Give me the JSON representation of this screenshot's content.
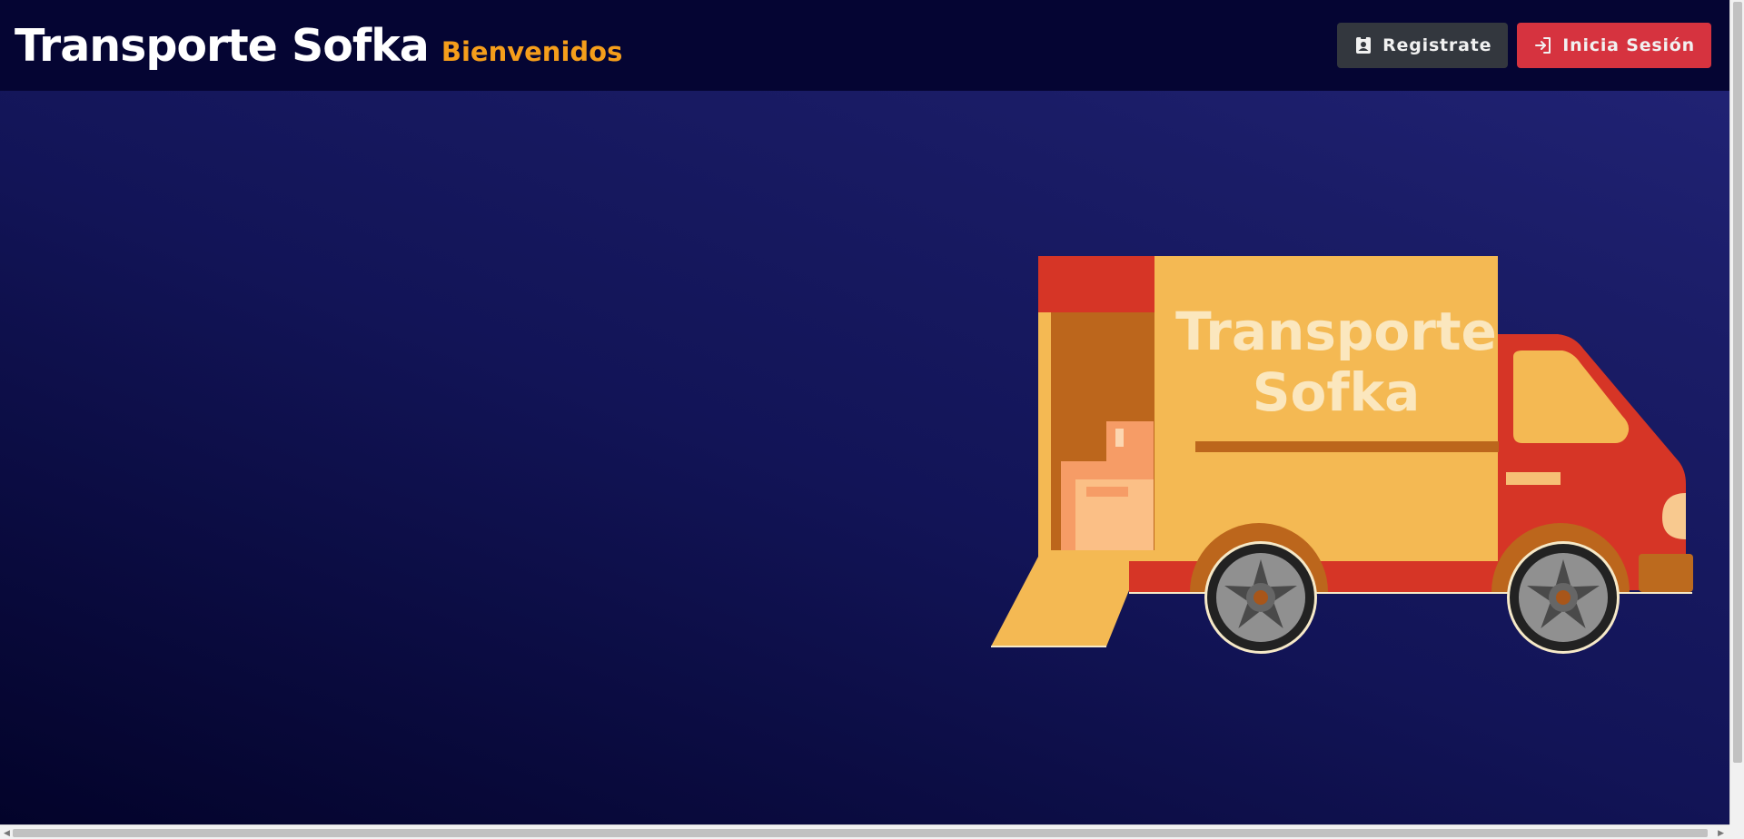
{
  "navbar": {
    "title": "Transporte Sofka",
    "subtitle": "Bienvenidos",
    "register_label": "Registrate",
    "register_icon": "id-badge-icon",
    "login_label": "Inicia Sesión",
    "login_icon": "sign-in-icon"
  },
  "hero": {
    "truck_text_line1": "Transporte",
    "truck_text_line2": "Sofka"
  },
  "colors": {
    "navbar_bg": "#050533",
    "subtitle": "#f59e1b",
    "register_button": "#33373e",
    "login_button": "#d6333f",
    "truck_box": "#f4b953",
    "truck_cab": "#d63526"
  }
}
